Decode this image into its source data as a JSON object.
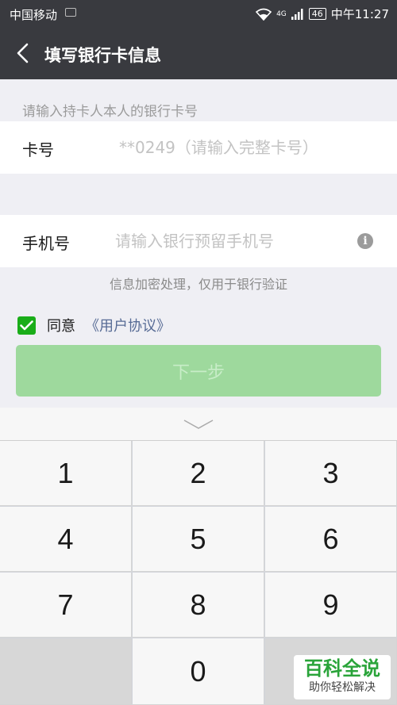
{
  "status_bar": {
    "carrier": "中国移动",
    "network": "4G",
    "battery": "46",
    "time": "中午11:27"
  },
  "nav": {
    "back_icon": "chevron-left-icon",
    "title": "填写银行卡信息"
  },
  "form": {
    "hint_top": "请输入持卡人本人的银行卡号",
    "card_label": "卡号",
    "card_placeholder": "**0249（请输入完整卡号）",
    "phone_label": "手机号",
    "phone_placeholder": "请输入银行预留手机号",
    "info_icon_glyph": "i",
    "privacy_hint": "信息加密处理，仅用于银行验证"
  },
  "agreement": {
    "checked": true,
    "label": "同意",
    "link_text": "《用户协议》"
  },
  "next_button": {
    "label": "下一步"
  },
  "keyboard": {
    "keys": [
      "1",
      "2",
      "3",
      "4",
      "5",
      "6",
      "7",
      "8",
      "9",
      "",
      "0",
      ""
    ]
  },
  "watermark": {
    "main": "百科全说",
    "sub": "助你轻松解决"
  },
  "colors": {
    "header_bg": "#393a3f",
    "accent_green": "#1aad19",
    "button_disabled": "#9ed99d",
    "link_blue": "#576b95"
  }
}
